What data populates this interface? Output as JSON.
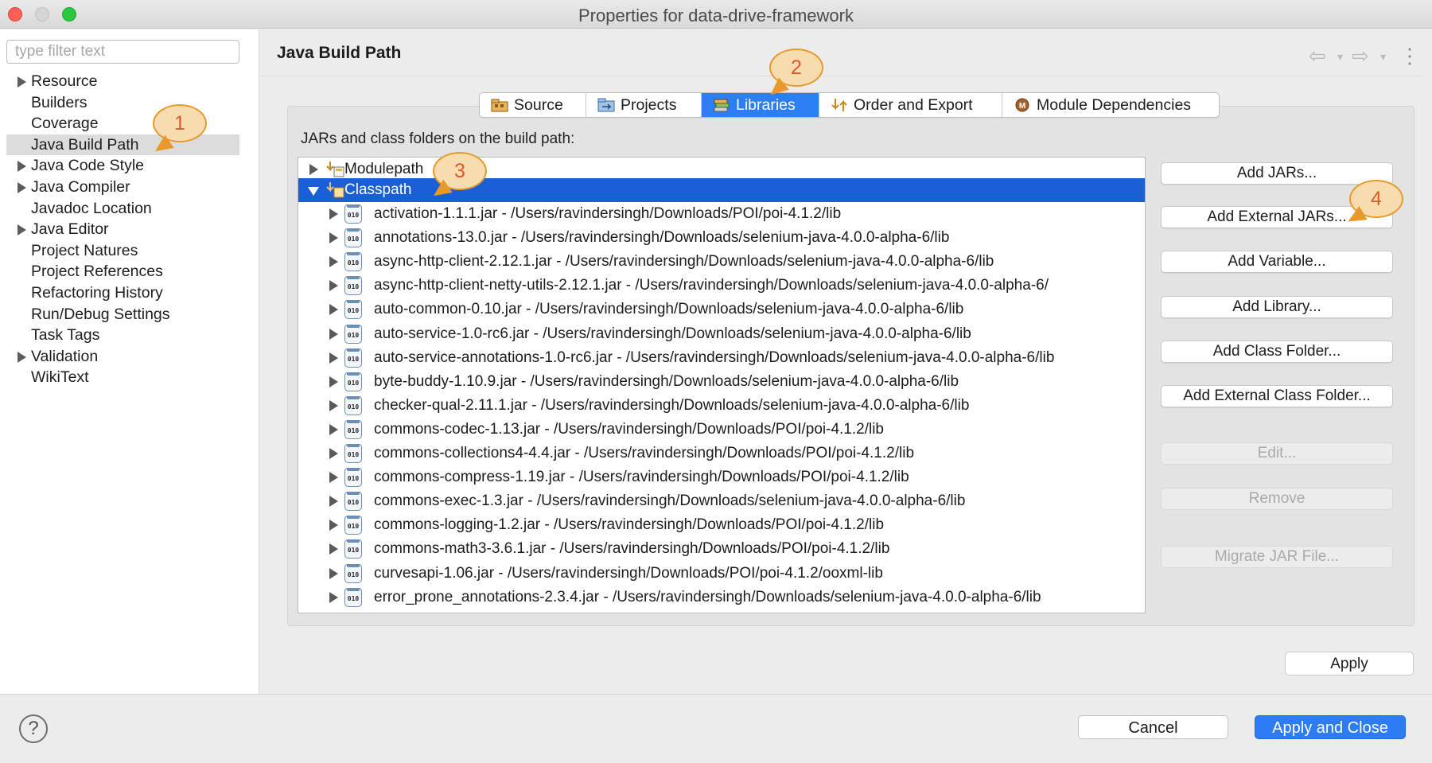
{
  "window": {
    "title": "Properties for data-drive-framework"
  },
  "sidebar": {
    "filter_placeholder": "type filter text",
    "items": [
      {
        "label": "Resource",
        "expandable": true
      },
      {
        "label": "Builders",
        "expandable": false
      },
      {
        "label": "Coverage",
        "expandable": false
      },
      {
        "label": "Java Build Path",
        "expandable": false,
        "selected": true
      },
      {
        "label": "Java Code Style",
        "expandable": true
      },
      {
        "label": "Java Compiler",
        "expandable": true
      },
      {
        "label": "Javadoc Location",
        "expandable": false
      },
      {
        "label": "Java Editor",
        "expandable": true
      },
      {
        "label": "Project Natures",
        "expandable": false
      },
      {
        "label": "Project References",
        "expandable": false
      },
      {
        "label": "Refactoring History",
        "expandable": false
      },
      {
        "label": "Run/Debug Settings",
        "expandable": false
      },
      {
        "label": "Task Tags",
        "expandable": false
      },
      {
        "label": "Validation",
        "expandable": true
      },
      {
        "label": "WikiText",
        "expandable": false
      }
    ]
  },
  "page": {
    "title": "Java Build Path",
    "tabs": [
      {
        "label": "Source",
        "icon": "source-folder-icon"
      },
      {
        "label": "Projects",
        "icon": "projects-folder-icon"
      },
      {
        "label": "Libraries",
        "icon": "libraries-icon",
        "active": true
      },
      {
        "label": "Order and Export",
        "icon": "order-export-icon"
      },
      {
        "label": "Module Dependencies",
        "icon": "module-dependencies-icon"
      }
    ],
    "path_label": "JARs and class folders on the build path:",
    "tree": {
      "modulepath": "Modulepath",
      "classpath": "Classpath",
      "jars": [
        "activation-1.1.1.jar - /Users/ravindersingh/Downloads/POI/poi-4.1.2/lib",
        "annotations-13.0.jar - /Users/ravindersingh/Downloads/selenium-java-4.0.0-alpha-6/lib",
        "async-http-client-2.12.1.jar - /Users/ravindersingh/Downloads/selenium-java-4.0.0-alpha-6/lib",
        "async-http-client-netty-utils-2.12.1.jar - /Users/ravindersingh/Downloads/selenium-java-4.0.0-alpha-6/",
        "auto-common-0.10.jar - /Users/ravindersingh/Downloads/selenium-java-4.0.0-alpha-6/lib",
        "auto-service-1.0-rc6.jar - /Users/ravindersingh/Downloads/selenium-java-4.0.0-alpha-6/lib",
        "auto-service-annotations-1.0-rc6.jar - /Users/ravindersingh/Downloads/selenium-java-4.0.0-alpha-6/lib",
        "byte-buddy-1.10.9.jar - /Users/ravindersingh/Downloads/selenium-java-4.0.0-alpha-6/lib",
        "checker-qual-2.11.1.jar - /Users/ravindersingh/Downloads/selenium-java-4.0.0-alpha-6/lib",
        "commons-codec-1.13.jar - /Users/ravindersingh/Downloads/POI/poi-4.1.2/lib",
        "commons-collections4-4.4.jar - /Users/ravindersingh/Downloads/POI/poi-4.1.2/lib",
        "commons-compress-1.19.jar - /Users/ravindersingh/Downloads/POI/poi-4.1.2/lib",
        "commons-exec-1.3.jar - /Users/ravindersingh/Downloads/selenium-java-4.0.0-alpha-6/lib",
        "commons-logging-1.2.jar - /Users/ravindersingh/Downloads/POI/poi-4.1.2/lib",
        "commons-math3-3.6.1.jar - /Users/ravindersingh/Downloads/POI/poi-4.1.2/lib",
        "curvesapi-1.06.jar - /Users/ravindersingh/Downloads/POI/poi-4.1.2/ooxml-lib",
        "error_prone_annotations-2.3.4.jar - /Users/ravindersingh/Downloads/selenium-java-4.0.0-alpha-6/lib"
      ],
      "jar_icon_text": "010"
    },
    "buttons": {
      "add_jars": "Add JARs...",
      "add_external_jars": "Add External JARs...",
      "add_variable": "Add Variable...",
      "add_library": "Add Library...",
      "add_class_folder": "Add Class Folder...",
      "add_external_class_folder": "Add External Class Folder...",
      "edit": "Edit...",
      "remove": "Remove",
      "migrate_jar": "Migrate JAR File...",
      "apply": "Apply"
    }
  },
  "footer": {
    "help": "?",
    "cancel": "Cancel",
    "apply_and_close": "Apply and Close"
  },
  "callouts": [
    "1",
    "2",
    "3",
    "4"
  ],
  "colors": {
    "accent": "#2c7ef3",
    "selection": "#1a5fd6",
    "callout_fill": "#f6dcae",
    "callout_border": "#e79a2b",
    "callout_text": "#e0582a"
  }
}
